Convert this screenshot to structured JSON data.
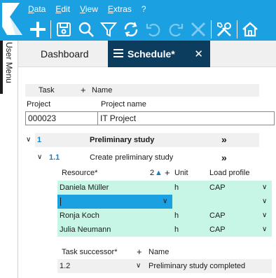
{
  "menu": [
    {
      "label": "Data",
      "ul": "D",
      "rest": "ata"
    },
    {
      "label": "Edit",
      "ul": "E",
      "rest": "dit"
    },
    {
      "label": "View",
      "ul": "V",
      "rest": "iew"
    },
    {
      "label": "Extras",
      "ul": "E",
      "rest": "xtras"
    },
    {
      "label": "?",
      "ul": "",
      "rest": "?"
    }
  ],
  "user_menu": "User Menu",
  "tabs": {
    "dashboard": "Dashboard",
    "schedule": "Schedule*"
  },
  "task_header": {
    "task": "Task",
    "plus": "+",
    "name": "Name"
  },
  "project": {
    "project_label": "Project",
    "project_name_label": "Project name",
    "project_value": "000023",
    "project_name_value": "IT Project"
  },
  "task1": {
    "number": "1",
    "name": "Preliminary study",
    "more": "»"
  },
  "task11": {
    "number": "1.1",
    "name": "Create preliminary study",
    "more": "»"
  },
  "resources": {
    "headers": {
      "resource": "Resource*",
      "sort": "2",
      "plus": "+",
      "unit": "Unit",
      "load": "Load profile"
    },
    "rows": [
      {
        "resource": "Daniela Müller",
        "unit": "h",
        "load": "CAP"
      },
      {
        "resource": "",
        "unit": "",
        "load": ""
      },
      {
        "resource": "Ronja Koch",
        "unit": "h",
        "load": "CAP"
      },
      {
        "resource": "Julia Neumann",
        "unit": "h",
        "load": "CAP"
      }
    ]
  },
  "successor": {
    "label": "Task successor*",
    "plus": "+",
    "name_label": "Name",
    "value": "1.2",
    "name_value": "Preliminary study completed"
  },
  "colors": {
    "topbar": "#1ba0e2",
    "active_tab": "#0d3d5e",
    "resource_row": "#c7f5e6",
    "selected_cell": "#1ba0e2",
    "task_number": "#1a7fc2"
  }
}
